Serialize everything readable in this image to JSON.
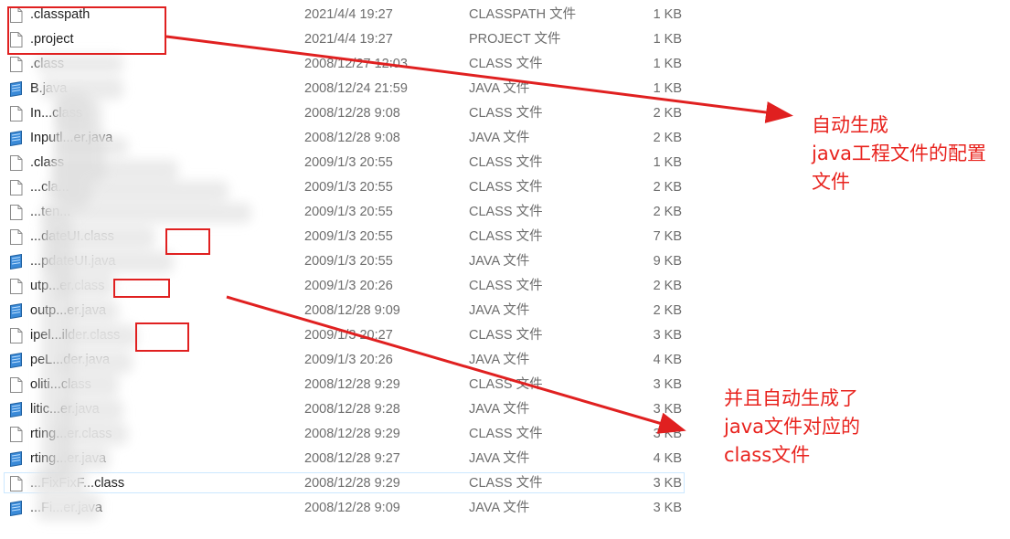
{
  "files": [
    {
      "name": ".classpath",
      "date": "2021/4/4 19:27",
      "type": "CLASSPATH 文件",
      "size": "1 KB",
      "icon": "doc-icon"
    },
    {
      "name": ".project",
      "date": "2021/4/4 19:27",
      "type": "PROJECT 文件",
      "size": "1 KB",
      "icon": "doc-icon"
    },
    {
      "name": ".class",
      "date": "2008/12/27 12:03",
      "type": "CLASS 文件",
      "size": "1 KB",
      "icon": "doc-icon"
    },
    {
      "name": "B.java",
      "date": "2008/12/24 21:59",
      "type": "JAVA 文件",
      "size": "1 KB",
      "icon": "java-icon"
    },
    {
      "name": "In...class",
      "date": "2008/12/28 9:08",
      "type": "CLASS 文件",
      "size": "2 KB",
      "icon": "doc-icon"
    },
    {
      "name": "Inputl...er.java",
      "date": "2008/12/28 9:08",
      "type": "JAVA 文件",
      "size": "2 KB",
      "icon": "java-icon"
    },
    {
      "name": ".class",
      "date": "2009/1/3 20:55",
      "type": "CLASS 文件",
      "size": "1 KB",
      "icon": "doc-icon"
    },
    {
      "name": "...cla...",
      "date": "2009/1/3 20:55",
      "type": "CLASS 文件",
      "size": "2 KB",
      "icon": "doc-icon"
    },
    {
      "name": "...ten...",
      "date": "2009/1/3 20:55",
      "type": "CLASS 文件",
      "size": "2 KB",
      "icon": "doc-icon"
    },
    {
      "name": "...dateUI.class",
      "date": "2009/1/3 20:55",
      "type": "CLASS 文件",
      "size": "7 KB",
      "icon": "doc-icon"
    },
    {
      "name": "...pdateUI.java",
      "date": "2009/1/3 20:55",
      "type": "JAVA 文件",
      "size": "9 KB",
      "icon": "java-icon"
    },
    {
      "name": "utp...er.class",
      "date": "2009/1/3 20:26",
      "type": "CLASS 文件",
      "size": "2 KB",
      "icon": "doc-icon"
    },
    {
      "name": "outp...er.java",
      "date": "2008/12/28 9:09",
      "type": "JAVA 文件",
      "size": "2 KB",
      "icon": "java-icon"
    },
    {
      "name": "ipel...ilder.class",
      "date": "2009/1/3 20:27",
      "type": "CLASS 文件",
      "size": "3 KB",
      "icon": "doc-icon"
    },
    {
      "name": "peL...der.java",
      "date": "2009/1/3 20:26",
      "type": "JAVA 文件",
      "size": "4 KB",
      "icon": "java-icon"
    },
    {
      "name": "oliti...class",
      "date": "2008/12/28 9:29",
      "type": "CLASS 文件",
      "size": "3 KB",
      "icon": "doc-icon"
    },
    {
      "name": "litic...er.java",
      "date": "2008/12/28 9:28",
      "type": "JAVA 文件",
      "size": "3 KB",
      "icon": "java-icon"
    },
    {
      "name": "rting...er.class",
      "date": "2008/12/28 9:29",
      "type": "CLASS 文件",
      "size": "3 KB",
      "icon": "doc-icon"
    },
    {
      "name": "rting...er.java",
      "date": "2008/12/28 9:27",
      "type": "JAVA 文件",
      "size": "4 KB",
      "icon": "java-icon"
    },
    {
      "name": "...FixFixF...class",
      "date": "2008/12/28 9:29",
      "type": "CLASS 文件",
      "size": "3 KB",
      "icon": "doc-icon"
    },
    {
      "name": "...Fi...er.java",
      "date": "2008/12/28 9:09",
      "type": "JAVA 文件",
      "size": "3 KB",
      "icon": "java-icon"
    }
  ],
  "annotations": {
    "top_label": [
      "自动生成",
      "java工程文件的配置",
      "文件"
    ],
    "bottom_label": [
      "并且自动生成了",
      "java文件对应的",
      "class文件"
    ]
  },
  "colors": {
    "accent": "#e02020",
    "java_icon": "#2f7fd0",
    "row_highlight_border": "#cce8ff"
  }
}
